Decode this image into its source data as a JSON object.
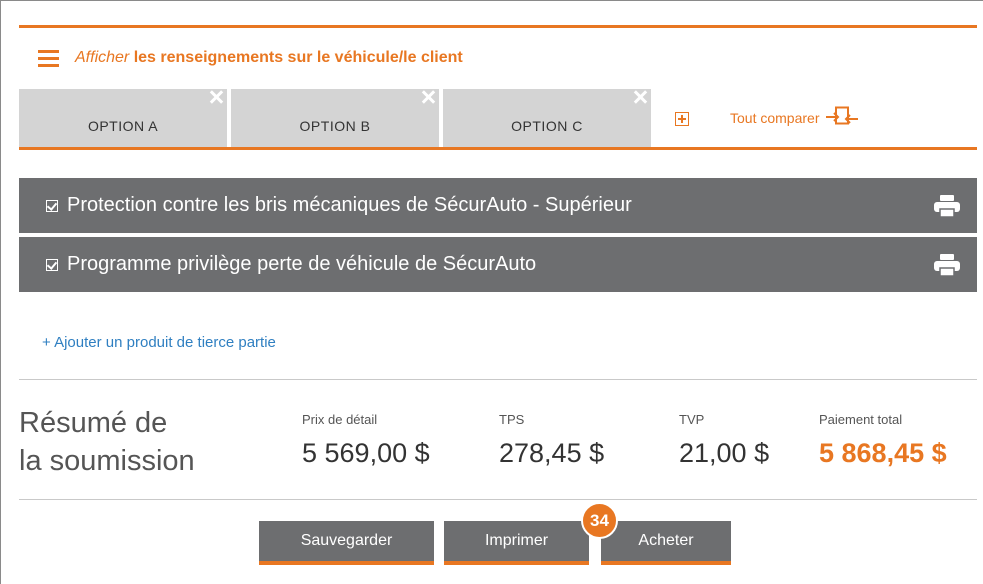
{
  "header": {
    "show_prefix": "Afficher",
    "show_rest": "les renseignements sur le véhicule/le client"
  },
  "tabs": [
    {
      "label": "OPTION  A"
    },
    {
      "label": "OPTION  B"
    },
    {
      "label": "OPTION  C"
    }
  ],
  "compare": {
    "label": "Tout comparer"
  },
  "products": [
    {
      "label": "Protection contre les bris mécaniques de SécurAuto - Supérieur"
    },
    {
      "label": "Programme privilège perte de véhicule de SécurAuto"
    }
  ],
  "add_product": {
    "label": "+ Ajouter un produit de tierce partie"
  },
  "summary": {
    "title_line1": "Résumé de",
    "title_line2": "la soumission",
    "retail_label": "Prix de détail",
    "retail_value": "5 569,00 $",
    "tps_label": "TPS",
    "tps_value": "278,45 $",
    "tvp_label": "TVP",
    "tvp_value": "21,00 $",
    "total_label": "Paiement total",
    "total_value": "5 868,45 $"
  },
  "actions": {
    "save_label": "Sauvegarder",
    "print_label": "Imprimer",
    "buy_label": "Acheter"
  },
  "badge": {
    "number": "34"
  },
  "colors": {
    "accent": "#e87722",
    "bar": "#6d6e70",
    "tab": "#d4d4d4",
    "link": "#2f7fc1"
  }
}
